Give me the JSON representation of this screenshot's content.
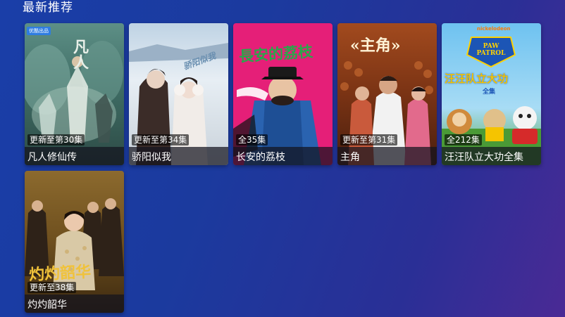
{
  "section": {
    "title": "最新推荐"
  },
  "cards": [
    {
      "title": "凡人修仙传",
      "badge": "更新至第30集",
      "tag": "优酷出品",
      "poster_text": "凡人"
    },
    {
      "title": "骄阳似我",
      "badge": "更新至第34集",
      "poster_text": "骄阳似我"
    },
    {
      "title": "长安的荔枝",
      "badge": "全35集",
      "poster_text": "長安的荔枝"
    },
    {
      "title": "主角",
      "badge": "更新至第31集",
      "poster_text": "«主角»"
    },
    {
      "title": "汪汪队立大功全集",
      "badge": "全212集",
      "poster_text": "汪汪队立大功",
      "poster_subtext": "全集",
      "logo_text": "PAW PATROL",
      "brand_text": "nickelodeon"
    },
    {
      "title": "灼灼韶华",
      "badge": "更新至38集",
      "poster_text": "灼灼韶华"
    }
  ],
  "colors": {
    "background": "#1b3a9e",
    "caption_bg": "#14141e",
    "accent": "#2f7de1"
  }
}
